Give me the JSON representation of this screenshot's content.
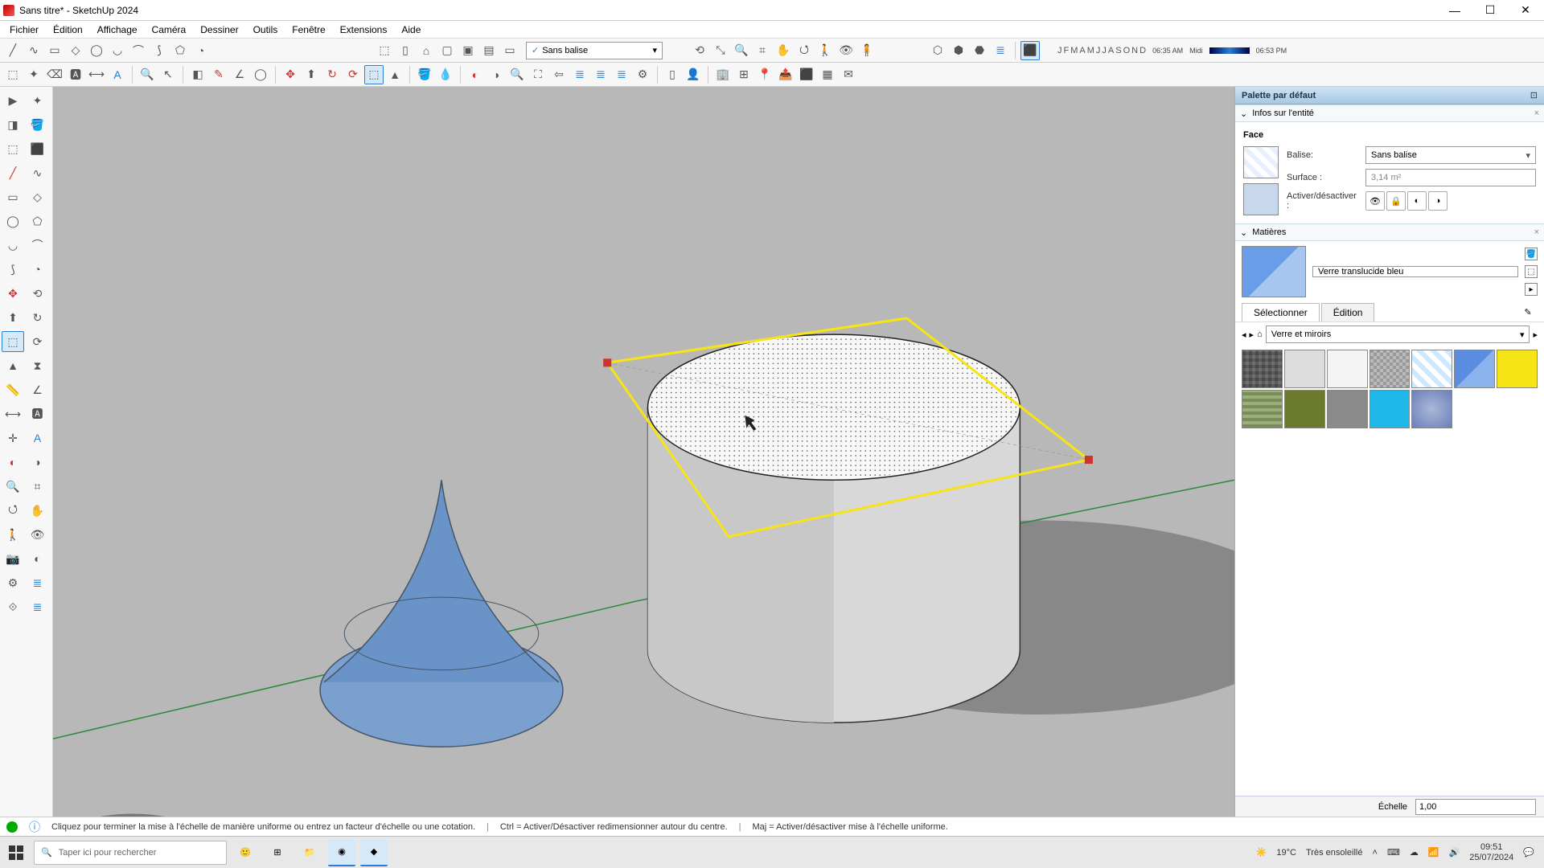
{
  "window": {
    "title": "Sans titre* - SketchUp 2024"
  },
  "menu": [
    "Fichier",
    "Édition",
    "Affichage",
    "Caméra",
    "Dessiner",
    "Outils",
    "Fenêtre",
    "Extensions",
    "Aide"
  ],
  "tag_dropdown": {
    "selected": "Sans balise",
    "check": "✓"
  },
  "shadow_times": {
    "start": "06:35 AM",
    "mid": "Midi",
    "end": "06:53 PM"
  },
  "months": [
    "J",
    "F",
    "M",
    "A",
    "M",
    "J",
    "J",
    "A",
    "S",
    "O",
    "N",
    "D"
  ],
  "right_panel": {
    "title": "Palette par défaut",
    "entity_header": "Infos sur l'entité",
    "entity_type": "Face",
    "labels": {
      "tag": "Balise:",
      "area": "Surface :",
      "toggle": "Activer/désactiver :"
    },
    "tag_value": "Sans balise",
    "area_value": "3,14 m²",
    "materials_header": "Matières",
    "material_name": "Verre translucide bleu",
    "tabs": {
      "select": "Sélectionner",
      "edit": "Édition"
    },
    "library": "Verre et miroirs",
    "swatches": [
      "#888",
      "#ddd",
      "#f4f4f4",
      "#b8b8b8",
      "#cde8ff",
      "#5a8de0",
      "#f7e416",
      "#7a8c5a",
      "#6b7a2e",
      "#8a8a8a",
      "#1fb6e8",
      "#6a7fb8"
    ]
  },
  "scale": {
    "label": "Échelle",
    "value": "1,00"
  },
  "status": {
    "hint": "Cliquez pour terminer la mise à l'échelle de manière uniforme ou entrez un facteur d'échelle ou une cotation.",
    "ctrl": "Ctrl = Activer/Désactiver redimensionner autour du centre.",
    "maj": "Maj = Activer/désactiver mise à l'échelle uniforme."
  },
  "taskbar": {
    "search_placeholder": "Taper ici pour rechercher",
    "weather_temp": "19°C",
    "weather_text": "Très ensoleillé",
    "time": "09:51",
    "date": "25/07/2024"
  }
}
